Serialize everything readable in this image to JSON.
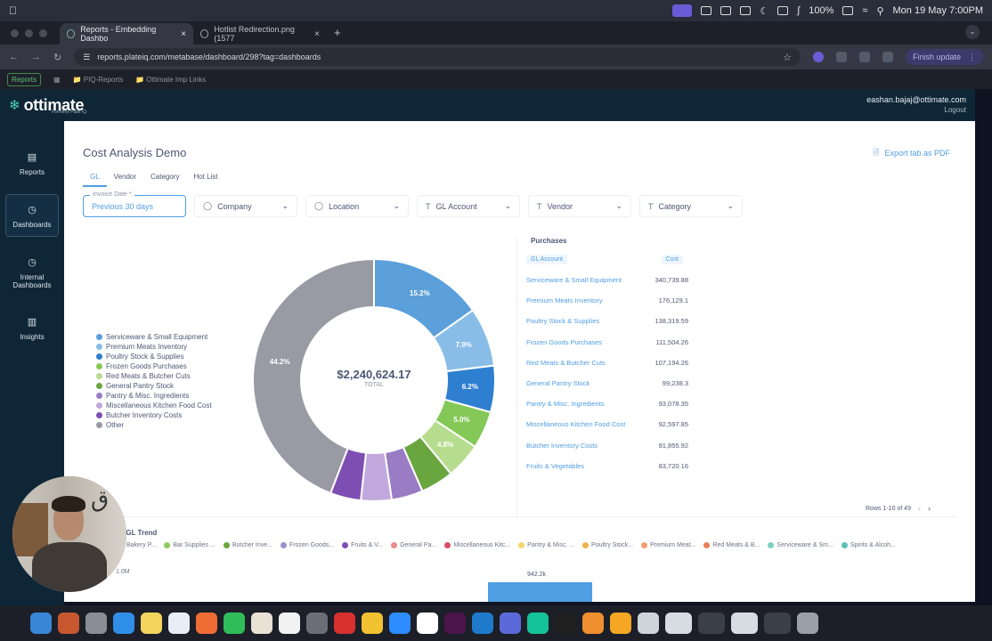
{
  "menubar": {
    "battery": "100%",
    "datetime": "Mon 19 May  7:00PM"
  },
  "browser": {
    "tabs": [
      {
        "title": "Reports - Embedding Dashbo",
        "active": true
      },
      {
        "title": "Hotlist Redirection.png (1577",
        "active": false
      }
    ],
    "url": "reports.plateiq.com/metabase/dashboard/298?tag=dashboards",
    "finish_update": "Finish update",
    "bookmarks": [
      "Reports",
      "PIQ-Reports",
      "Ottimate Imp Links"
    ]
  },
  "header": {
    "brand": "ottimate",
    "brand_tag": "Formerly Plate IQ",
    "user_email": "eashan.bajaj@ottimate.com",
    "logout": "Logout"
  },
  "sidebar": {
    "items": [
      {
        "label": "Reports",
        "icon": "reports-icon",
        "active": false
      },
      {
        "label": "Dashboards",
        "icon": "dashboards-icon",
        "active": true
      },
      {
        "label": "Internal Dashboards",
        "icon": "internal-dashboards-icon",
        "active": false
      },
      {
        "label": "Insights",
        "icon": "insights-icon",
        "active": false
      }
    ]
  },
  "dashboard": {
    "title": "Cost Analysis Demo",
    "export": "Export tab as PDF",
    "tabs": [
      "GL",
      "Vendor",
      "Category",
      "Hot List"
    ],
    "active_tab": "GL",
    "filters": {
      "date_label": "Invoice Date *",
      "date_value": "Previous 30 days",
      "company": "Company",
      "location": "Location",
      "gl_account": "GL Account",
      "vendor": "Vendor",
      "category": "Category"
    }
  },
  "donut": {
    "total_value": "$2,240,624.17",
    "total_label": "TOTAL",
    "legend": [
      {
        "label": "Serviceware & Small Equipment",
        "color": "#5b9fdb"
      },
      {
        "label": "Premium Meats Inventory",
        "color": "#89bde8"
      },
      {
        "label": "Poultry Stock & Supplies",
        "color": "#2f7fd0"
      },
      {
        "label": "Frozen Goods Purchases",
        "color": "#84c857"
      },
      {
        "label": "Red Meats & Butcher Cuts",
        "color": "#b6dc8e"
      },
      {
        "label": "General Pantry Stock",
        "color": "#6aa640"
      },
      {
        "label": "Pantry & Misc. Ingredients",
        "color": "#9a7cc5"
      },
      {
        "label": "Miscellaneous Kitchen Food Cost",
        "color": "#c1a9dd"
      },
      {
        "label": "Butcher Inventory Costs",
        "color": "#7e4fb3"
      },
      {
        "label": "Other",
        "color": "#999aa4"
      }
    ]
  },
  "chart_data": {
    "type": "pie",
    "categories": [
      "Serviceware & Small Equipment",
      "Premium Meats Inventory",
      "Poultry Stock & Supplies",
      "Frozen Goods Purchases",
      "Red Meats & Butcher Cuts",
      "General Pantry Stock",
      "Pantry & Misc. Ingredients",
      "Miscellaneous Kitchen Food Cost",
      "Butcher Inventory Costs",
      "Other"
    ],
    "values": [
      15.2,
      7.9,
      6.2,
      5.0,
      4.8,
      4.4,
      4.2,
      4.1,
      4.1,
      44.2
    ],
    "labels": [
      "15.2%",
      "7.9%",
      "6.2%",
      "5.0%",
      "4.8%",
      "",
      "",
      "",
      "",
      "44.2%"
    ]
  },
  "purchases": {
    "title": "Purchases",
    "col_account": "GL Account",
    "col_cost": "Cost",
    "rows": [
      {
        "account": "Serviceware & Small Equipment",
        "cost": "340,739.88"
      },
      {
        "account": "Premium Meats Inventory",
        "cost": "176,129.1"
      },
      {
        "account": "Poultry Stock & Supplies",
        "cost": "138,319.59"
      },
      {
        "account": "Frozen Goods Purchases",
        "cost": "111,504.26"
      },
      {
        "account": "Red Meats & Butcher Cuts",
        "cost": "107,194.26"
      },
      {
        "account": "General Pantry Stock",
        "cost": "99,238.3"
      },
      {
        "account": "Pantry & Misc. Ingredients",
        "cost": "93,078.35"
      },
      {
        "account": "Miscellaneous Kitchen Food Cost",
        "cost": "92,597.85"
      },
      {
        "account": "Butcher Inventory Costs",
        "cost": "91,855.92"
      },
      {
        "account": "Fruits & Vegetables",
        "cost": "83,720.16"
      }
    ],
    "pager": "Rows 1-10 of 49"
  },
  "trend": {
    "title": "Cost Analysis by GL Trend",
    "visible_title": "ysis by GL Trend",
    "legend": [
      {
        "label": "Bakery P...",
        "color": "#a5c4e6"
      },
      {
        "label": "Bar Supplies ...",
        "color": "#8fc95e"
      },
      {
        "label": "Butcher Inve...",
        "color": "#6aa640"
      },
      {
        "label": "Frozen Goods...",
        "color": "#9a8fd0"
      },
      {
        "label": "Fruits & V...",
        "color": "#7e4fb3"
      },
      {
        "label": "General Pa...",
        "color": "#ea8a8a"
      },
      {
        "label": "Miscellaneous Kitc...",
        "color": "#d94a6a"
      },
      {
        "label": "Pantry & Misc. ...",
        "color": "#f2d66a"
      },
      {
        "label": "Poultry Stock...",
        "color": "#f2b14a"
      },
      {
        "label": "Premium Meat...",
        "color": "#f0a070"
      },
      {
        "label": "Red Meats & B...",
        "color": "#e8805a"
      },
      {
        "label": "Serviceware & Sm...",
        "color": "#7ad3c0"
      },
      {
        "label": "Spirits & Alcoh...",
        "color": "#5cc0b5"
      }
    ],
    "y_tick": "1.0M",
    "bar_label": "942.2k"
  }
}
